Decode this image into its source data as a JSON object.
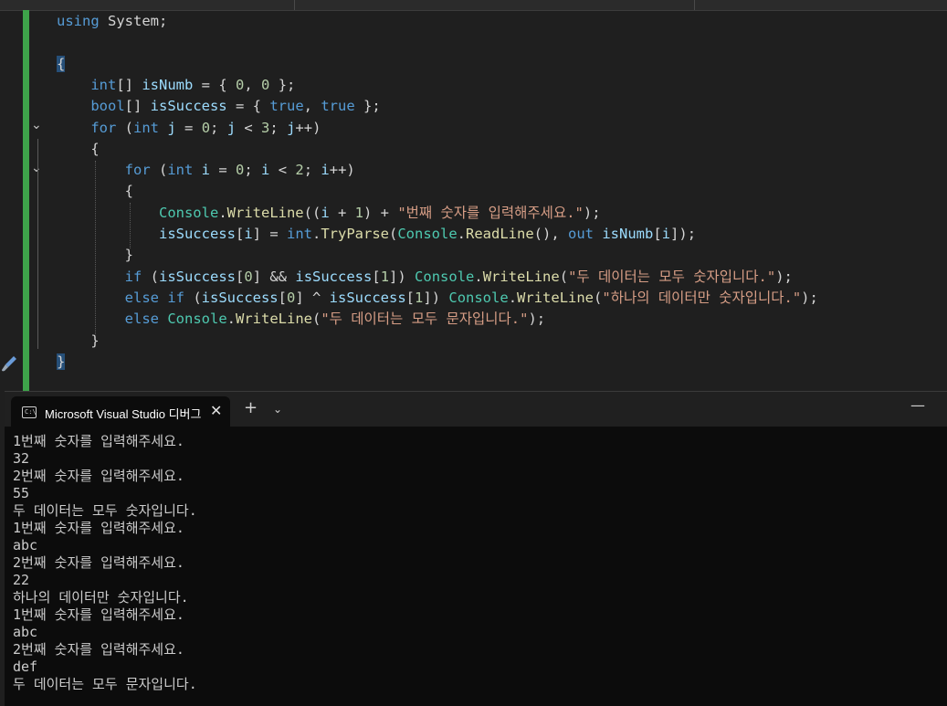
{
  "editor": {
    "lines": [
      [
        {
          "t": "using ",
          "c": "kw"
        },
        {
          "t": "System;",
          "c": ""
        }
      ],
      [],
      [
        {
          "t": "{",
          "c": "bh"
        }
      ],
      [
        {
          "t": "    ",
          "c": ""
        },
        {
          "t": "int",
          "c": "kw"
        },
        {
          "t": "[] ",
          "c": ""
        },
        {
          "t": "isNumb",
          "c": "vr"
        },
        {
          "t": " = { ",
          "c": ""
        },
        {
          "t": "0",
          "c": "nm"
        },
        {
          "t": ", ",
          "c": ""
        },
        {
          "t": "0",
          "c": "nm"
        },
        {
          "t": " };",
          "c": ""
        }
      ],
      [
        {
          "t": "    ",
          "c": ""
        },
        {
          "t": "bool",
          "c": "kw"
        },
        {
          "t": "[] ",
          "c": ""
        },
        {
          "t": "isSuccess",
          "c": "vr"
        },
        {
          "t": " = { ",
          "c": ""
        },
        {
          "t": "true",
          "c": "kw"
        },
        {
          "t": ", ",
          "c": ""
        },
        {
          "t": "true",
          "c": "kw"
        },
        {
          "t": " };",
          "c": ""
        }
      ],
      [
        {
          "t": "    ",
          "c": ""
        },
        {
          "t": "for",
          "c": "kw"
        },
        {
          "t": " (",
          "c": ""
        },
        {
          "t": "int",
          "c": "kw"
        },
        {
          "t": " ",
          "c": ""
        },
        {
          "t": "j",
          "c": "vr"
        },
        {
          "t": " = ",
          "c": ""
        },
        {
          "t": "0",
          "c": "nm"
        },
        {
          "t": "; ",
          "c": ""
        },
        {
          "t": "j",
          "c": "vr"
        },
        {
          "t": " < ",
          "c": ""
        },
        {
          "t": "3",
          "c": "nm"
        },
        {
          "t": "; ",
          "c": ""
        },
        {
          "t": "j",
          "c": "vr"
        },
        {
          "t": "++)",
          "c": ""
        }
      ],
      [
        {
          "t": "    {",
          "c": ""
        }
      ],
      [
        {
          "t": "        ",
          "c": ""
        },
        {
          "t": "for",
          "c": "kw"
        },
        {
          "t": " (",
          "c": ""
        },
        {
          "t": "int",
          "c": "kw"
        },
        {
          "t": " ",
          "c": ""
        },
        {
          "t": "i",
          "c": "vr"
        },
        {
          "t": " = ",
          "c": ""
        },
        {
          "t": "0",
          "c": "nm"
        },
        {
          "t": "; ",
          "c": ""
        },
        {
          "t": "i",
          "c": "vr"
        },
        {
          "t": " < ",
          "c": ""
        },
        {
          "t": "2",
          "c": "nm"
        },
        {
          "t": "; ",
          "c": ""
        },
        {
          "t": "i",
          "c": "vr"
        },
        {
          "t": "++)",
          "c": ""
        }
      ],
      [
        {
          "t": "        {",
          "c": ""
        }
      ],
      [
        {
          "t": "            ",
          "c": ""
        },
        {
          "t": "Console",
          "c": "ty"
        },
        {
          "t": ".",
          "c": ""
        },
        {
          "t": "WriteLine",
          "c": "mt"
        },
        {
          "t": "((",
          "c": ""
        },
        {
          "t": "i",
          "c": "vr"
        },
        {
          "t": " + ",
          "c": ""
        },
        {
          "t": "1",
          "c": "nm"
        },
        {
          "t": ") + ",
          "c": ""
        },
        {
          "t": "\"번째 숫자를 입력해주세요.\"",
          "c": "st"
        },
        {
          "t": ");",
          "c": ""
        }
      ],
      [
        {
          "t": "            ",
          "c": ""
        },
        {
          "t": "isSuccess",
          "c": "vr"
        },
        {
          "t": "[",
          "c": ""
        },
        {
          "t": "i",
          "c": "vr"
        },
        {
          "t": "] = ",
          "c": ""
        },
        {
          "t": "int",
          "c": "kw"
        },
        {
          "t": ".",
          "c": ""
        },
        {
          "t": "TryParse",
          "c": "mt"
        },
        {
          "t": "(",
          "c": ""
        },
        {
          "t": "Console",
          "c": "ty"
        },
        {
          "t": ".",
          "c": ""
        },
        {
          "t": "ReadLine",
          "c": "mt"
        },
        {
          "t": "(), ",
          "c": ""
        },
        {
          "t": "out",
          "c": "kw"
        },
        {
          "t": " ",
          "c": ""
        },
        {
          "t": "isNumb",
          "c": "vr"
        },
        {
          "t": "[",
          "c": ""
        },
        {
          "t": "i",
          "c": "vr"
        },
        {
          "t": "]);",
          "c": ""
        }
      ],
      [
        {
          "t": "        }",
          "c": ""
        }
      ],
      [
        {
          "t": "        ",
          "c": ""
        },
        {
          "t": "if",
          "c": "kw"
        },
        {
          "t": " (",
          "c": ""
        },
        {
          "t": "isSuccess",
          "c": "vr"
        },
        {
          "t": "[",
          "c": ""
        },
        {
          "t": "0",
          "c": "nm"
        },
        {
          "t": "] && ",
          "c": ""
        },
        {
          "t": "isSuccess",
          "c": "vr"
        },
        {
          "t": "[",
          "c": ""
        },
        {
          "t": "1",
          "c": "nm"
        },
        {
          "t": "]) ",
          "c": ""
        },
        {
          "t": "Console",
          "c": "ty"
        },
        {
          "t": ".",
          "c": ""
        },
        {
          "t": "WriteLine",
          "c": "mt"
        },
        {
          "t": "(",
          "c": ""
        },
        {
          "t": "\"두 데이터는 모두 숫자입니다.\"",
          "c": "st"
        },
        {
          "t": ");",
          "c": ""
        }
      ],
      [
        {
          "t": "        ",
          "c": ""
        },
        {
          "t": "else if",
          "c": "kw"
        },
        {
          "t": " (",
          "c": ""
        },
        {
          "t": "isSuccess",
          "c": "vr"
        },
        {
          "t": "[",
          "c": ""
        },
        {
          "t": "0",
          "c": "nm"
        },
        {
          "t": "] ^ ",
          "c": ""
        },
        {
          "t": "isSuccess",
          "c": "vr"
        },
        {
          "t": "[",
          "c": ""
        },
        {
          "t": "1",
          "c": "nm"
        },
        {
          "t": "]) ",
          "c": ""
        },
        {
          "t": "Console",
          "c": "ty"
        },
        {
          "t": ".",
          "c": ""
        },
        {
          "t": "WriteLine",
          "c": "mt"
        },
        {
          "t": "(",
          "c": ""
        },
        {
          "t": "\"하나의 데이터만 숫자입니다.\"",
          "c": "st"
        },
        {
          "t": ");",
          "c": ""
        }
      ],
      [
        {
          "t": "        ",
          "c": ""
        },
        {
          "t": "else",
          "c": "kw"
        },
        {
          "t": " ",
          "c": ""
        },
        {
          "t": "Console",
          "c": "ty"
        },
        {
          "t": ".",
          "c": ""
        },
        {
          "t": "WriteLine",
          "c": "mt"
        },
        {
          "t": "(",
          "c": ""
        },
        {
          "t": "\"두 데이터는 모두 문자입니다.\"",
          "c": "st"
        },
        {
          "t": ");",
          "c": ""
        }
      ],
      [
        {
          "t": "    }",
          "c": ""
        }
      ],
      [
        {
          "t": "}",
          "c": "bh"
        }
      ]
    ],
    "fold_glyph": "⌄",
    "brush_icon": "paintbrush-icon"
  },
  "terminal": {
    "tab_title": "Microsoft Visual Studio 디버그",
    "tab_icon_text": "C:\\",
    "close_glyph": "✕",
    "new_tab_glyph": "+",
    "dropdown_glyph": "⌄",
    "minimize_glyph": "—",
    "output": [
      "1번째 숫자를 입력해주세요.",
      "32",
      "2번째 숫자를 입력해주세요.",
      "55",
      "두 데이터는 모두 숫자입니다.",
      "1번째 숫자를 입력해주세요.",
      "abc",
      "2번째 숫자를 입력해주세요.",
      "22",
      "하나의 데이터만 숫자입니다.",
      "1번째 숫자를 입력해주세요.",
      "abc",
      "2번째 숫자를 입력해주세요.",
      "def",
      "두 데이터는 모두 문자입니다."
    ]
  },
  "colors": {
    "keyword": "#569cd6",
    "type": "#4ec9b0",
    "method": "#dcdcaa",
    "string": "#d69d85",
    "variable": "#9cdcfe",
    "number": "#b5cea8",
    "change_bar": "#3ea34a"
  }
}
